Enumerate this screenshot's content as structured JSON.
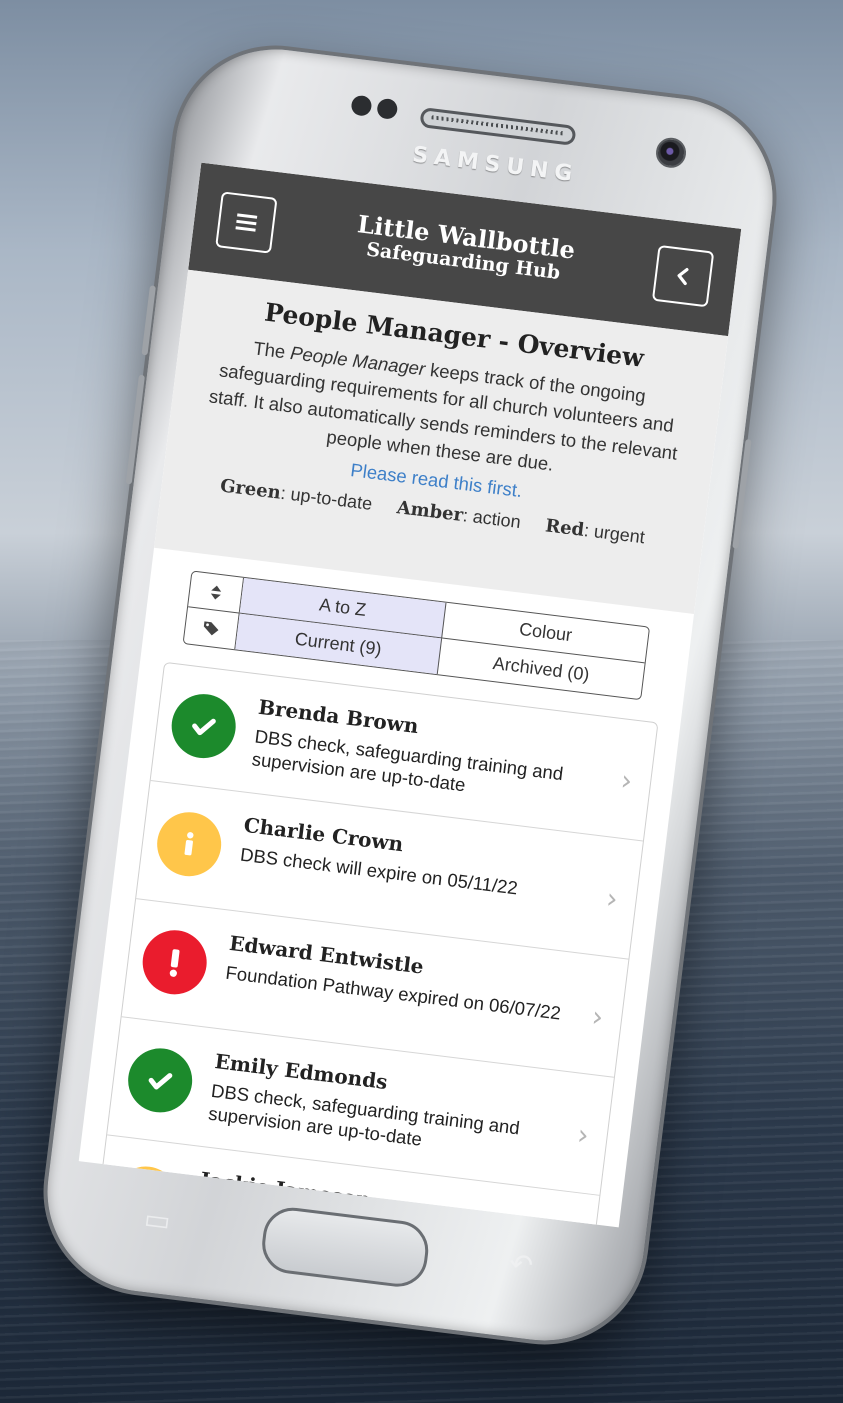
{
  "device": {
    "brand": "SAMSUNG"
  },
  "header": {
    "title": "Little Wallbottle",
    "subtitle": "Safeguarding Hub",
    "menu_icon": "hamburger-icon",
    "back_icon": "chevron-left-icon"
  },
  "intro": {
    "title": "People Manager - Overview",
    "text_before": "The ",
    "text_em": "People Manager",
    "text_after": " keeps track of the ongoing safeguarding requirements for all church volunteers and staff.  It also automatically sends reminders to the relevant people when these are due.",
    "link": "Please read this first.",
    "legend": [
      {
        "label": "Green",
        "desc": ": up-to-date"
      },
      {
        "label": "Amber",
        "desc": ": action"
      },
      {
        "label": "Red",
        "desc": ": urgent"
      }
    ]
  },
  "filters": {
    "sort_icon": "sort-icon",
    "tag_icon": "tag-icon",
    "sort_options": [
      "A to Z",
      "Colour"
    ],
    "view_options": [
      "Current (9)",
      "Archived (0)"
    ],
    "selected_sort": "A to Z",
    "selected_view": "Current (9)"
  },
  "people": [
    {
      "name": "Brenda Brown",
      "status": "DBS check, safeguarding training and supervision are up-to-date",
      "level": "green",
      "icon": "check-icon"
    },
    {
      "name": "Charlie Crown",
      "status": "DBS check will expire on 05/11/22",
      "level": "amber",
      "icon": "info-icon"
    },
    {
      "name": "Edward Entwistle",
      "status": "Foundation Pathway expired on 06/07/22",
      "level": "red",
      "icon": "exclamation-icon"
    },
    {
      "name": "Emily Edmonds",
      "status": "DBS check, safeguarding training and supervision are up-to-date",
      "level": "green",
      "icon": "check-icon"
    },
    {
      "name": "Jackie Jameson",
      "status": "",
      "level": "amber",
      "icon": "info-icon"
    }
  ],
  "colors": {
    "header_bg": "#474747",
    "green": "#1c8a2c",
    "amber": "#ffc64a",
    "red": "#ea1c2d",
    "link": "#3d7fc8",
    "selected_filter": "#e4e4f8"
  }
}
